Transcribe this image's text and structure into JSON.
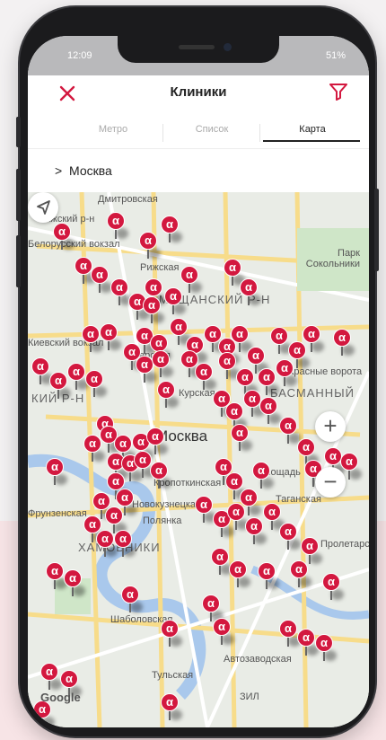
{
  "status": {
    "time": "12:09",
    "battery": "51%"
  },
  "header": {
    "title": "Клиники"
  },
  "tabs": [
    {
      "label": "Метро"
    },
    {
      "label": "Список"
    },
    {
      "label": "Карта"
    }
  ],
  "active_tab": "Карта",
  "city": {
    "chevron": ">",
    "name": "Москва"
  },
  "map": {
    "center_label": "Москва",
    "district_labels": [
      "МЕЩАНСКИЙ Р-Н",
      "БАСМАННЫЙ",
      "КИЙ Р-Н",
      "ХАМОВНИКИ"
    ],
    "place_labels": [
      "Дмитровская",
      "Рижский р-н",
      "Рижская",
      "Парк Сокольники",
      "Белорусский вокзал",
      "Тверская",
      "Кропоткинская",
      "Новокузнецкая",
      "Полянка",
      "Таганская",
      "Площадь",
      "Шаболовская",
      "Тульская",
      "Автозаводская",
      "ЗИЛ",
      "Красные ворота",
      "Курская",
      "Фрунзенская",
      "Киевский вокзал",
      "Пролетарская"
    ],
    "pin_glyph": "α",
    "google_label": "Google",
    "zoom_in": "+",
    "zoom_out": "−"
  },
  "colors": {
    "accent": "#d3183f",
    "pin": "#d3183f",
    "map_bg": "#e9ece6"
  },
  "icons": {
    "close": "close-icon",
    "filter": "filter-icon",
    "locate": "navigation-arrow-icon"
  }
}
